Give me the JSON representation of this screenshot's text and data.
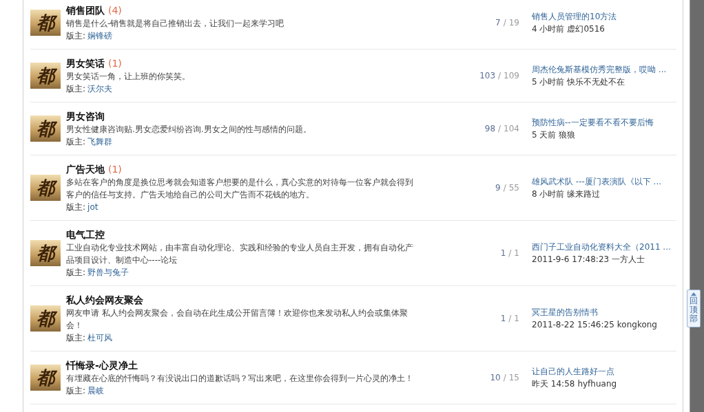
{
  "forums": [
    {
      "icon_text": "都",
      "name": "销售团队",
      "new_count": "(4)",
      "description": "销售是什么-销售就是将自己推销出去，让我们一起来学习吧",
      "moderator_label": "版主:",
      "moderator": "娴锋磅",
      "topics": "7",
      "separator": "/",
      "posts": "19",
      "last_post": {
        "title": "销售人员管理的10方法",
        "time": "4 小时前",
        "author": "虚幻0516"
      }
    },
    {
      "icon_text": "都",
      "name": "男女笑话",
      "new_count": "(1)",
      "description": "男女笑话一角，让上班的你笑笑。",
      "moderator_label": "版主:",
      "moderator": "沃尔夫",
      "topics": "103",
      "separator": "/",
      "posts": "109",
      "last_post": {
        "title": "周杰伦兔斯基模仿秀完整版，哎呦 ...",
        "time": "5 小时前",
        "author": "快乐不无处不在"
      }
    },
    {
      "icon_text": "都",
      "name": "男女咨询",
      "description": "男女性健康咨询贴.男女恋爱纠纷咨询.男女之间的性与感情的问题。",
      "moderator_label": "版主:",
      "moderator": "飞舞群",
      "topics": "98",
      "separator": "/",
      "posts": "104",
      "last_post": {
        "title": "预防性病--一定要看不看不要后悔",
        "time": "5 天前",
        "author": "狼狼"
      }
    },
    {
      "icon_text": "都",
      "name": "广告天地",
      "new_count": "(1)",
      "description": "多站在客户的角度是换位思考就会知道客户想要的是什么，真心实意的对待每一位客户就会得到客户的信任与支持。广告天地给自己的公司大广告而不花钱的地方。",
      "moderator_label": "版主:",
      "moderator": "jot",
      "topics": "9",
      "separator": "/",
      "posts": "55",
      "last_post": {
        "title": "雄风武术队 ---厦门表演队《以下 ...",
        "time": "8 小时前",
        "author": "缘来路过"
      }
    },
    {
      "icon_text": "都",
      "name": "电气工控",
      "description": "工业自动化专业技术网站，由丰富自动化理论、实践和经验的专业人员自主开发，拥有自动化产品项目设计、制造中心----论坛",
      "moderator_label": "版主:",
      "moderator": "野兽与兔子",
      "topics": "1",
      "separator": "/",
      "posts": "1",
      "last_post": {
        "title": "西门子工业自动化资料大全（2011 ...",
        "time": "2011-9-6 17:48:23",
        "author": "一方人士"
      }
    },
    {
      "icon_text": "都",
      "name": "私人约会网友聚会",
      "description": "网友申请 私人约会网友聚会，会自动在此生成公开留言簿！欢迎你也来发动私人约会或集体聚会！",
      "moderator_label": "版主:",
      "moderator": "杜可风",
      "topics": "1",
      "separator": "/",
      "posts": "1",
      "last_post": {
        "title": "冥王星的告别情书",
        "time": "2011-8-22 15:46:25",
        "author": "kongkong"
      }
    },
    {
      "icon_text": "都",
      "name": "忏悔录-心灵净土",
      "description": "有埋藏在心底的忏悔吗？有没说出口的道歉话吗？写出来吧，在这里你会得到一片心灵的净土！",
      "moderator_label": "版主:",
      "moderator": "晨岐",
      "topics": "10",
      "separator": "/",
      "posts": "15",
      "last_post": {
        "title": "让自己的人生路好一点",
        "time": "昨天 14:58",
        "author": "hyfhuang"
      }
    }
  ],
  "back_to_top": {
    "label": "回顶部"
  }
}
